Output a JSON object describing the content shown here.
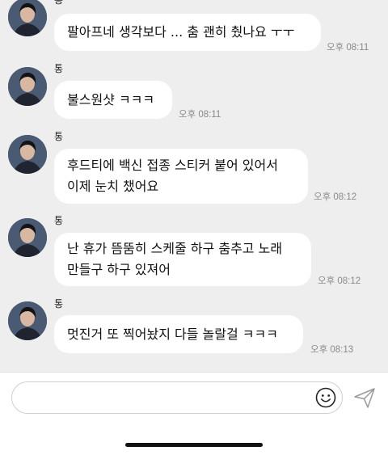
{
  "messages": [
    {
      "sender": "통",
      "lines": [
        "팔아프네 생각보다 ... 춤 괜히 췄나요 ㅜㅜ"
      ],
      "time": "오후 08:11"
    },
    {
      "sender": "통",
      "lines": [
        "불스원샷 ㅋㅋㅋ"
      ],
      "time": "오후 08:11"
    },
    {
      "sender": "통",
      "lines": [
        "후드티에 백신 접종 스티커 붙어 있어서",
        "이제 눈치 챘어요"
      ],
      "time": "오후 08:12"
    },
    {
      "sender": "통",
      "lines": [
        "난 휴가 뜸뚬히 스케줄 하구 춤추고 노래",
        "만들구 하구 있져어"
      ],
      "time": "오후 08:12"
    },
    {
      "sender": "통",
      "lines": [
        "멋진거 또 찍어놨지 다들 놀랄걸 ㅋㅋㅋ"
      ],
      "time": "오후 08:13"
    }
  ],
  "composer": {
    "placeholder": ""
  },
  "icons": {
    "emoji": "smiley-face-icon",
    "send": "paper-plane-send-icon",
    "avatar": "profile-photo"
  },
  "colors": {
    "chat_bg": "#eeeeee",
    "bubble": "#ffffff",
    "time_text": "#8a8a8a"
  }
}
